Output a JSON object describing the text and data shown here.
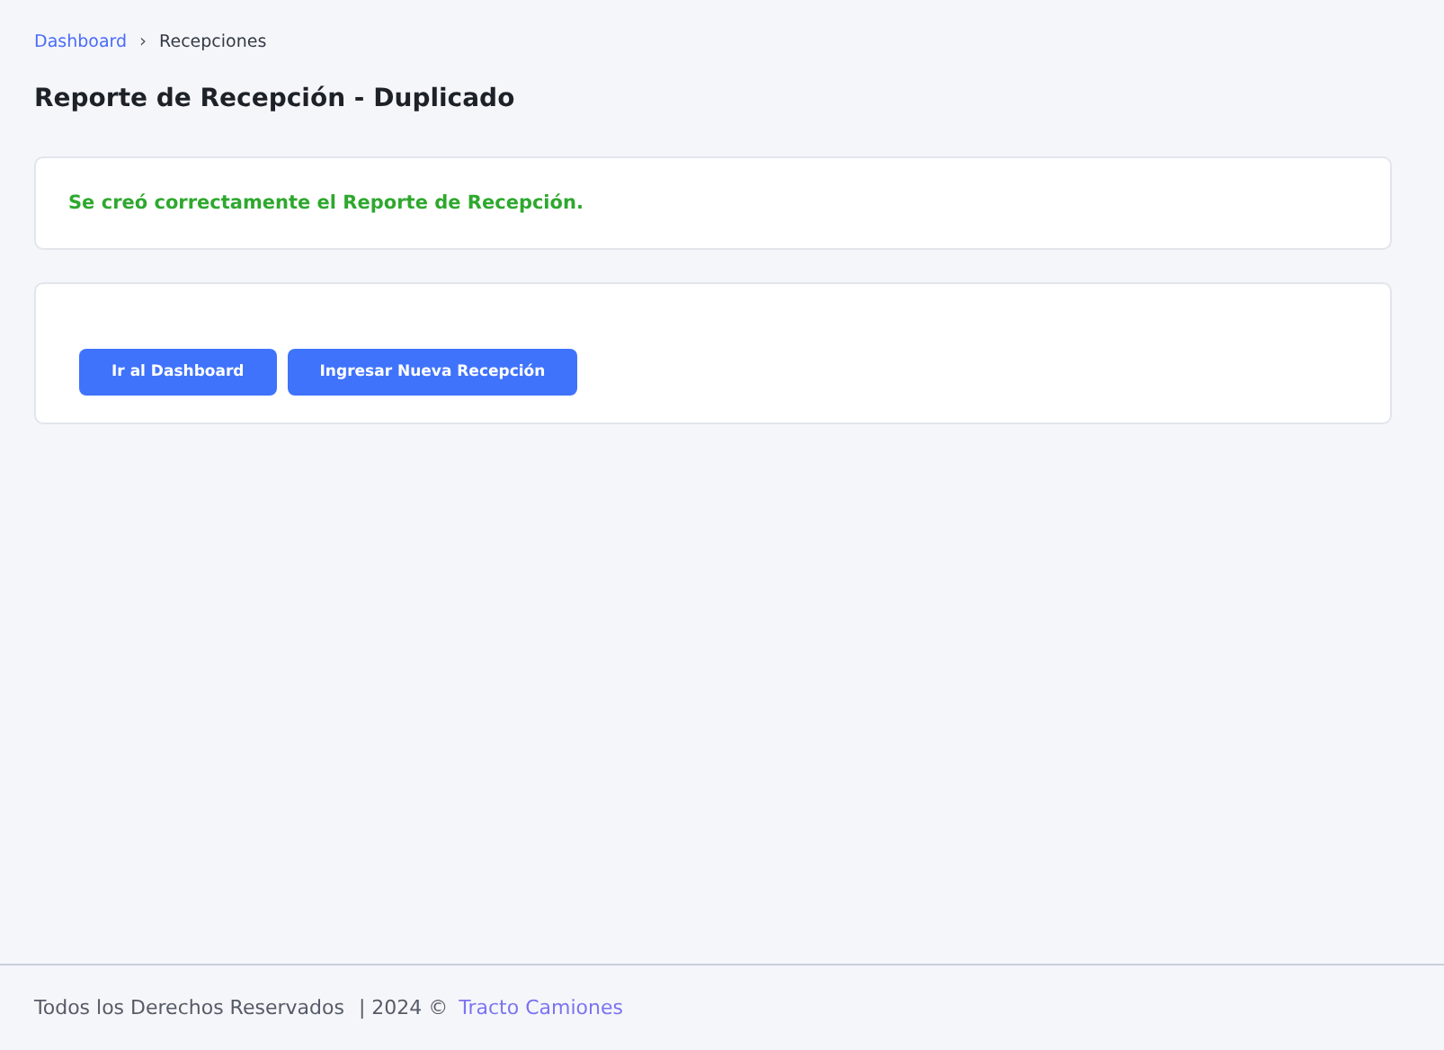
{
  "breadcrumb": {
    "items": [
      {
        "label": "Dashboard",
        "kind": "link"
      },
      {
        "label": "Recepciones",
        "kind": "current"
      }
    ],
    "separator": "›"
  },
  "title": "Reporte de Recepción - Duplicado",
  "alert": {
    "message": "Se creó correctamente el Reporte de Recepción."
  },
  "buttons": [
    {
      "label": "Ir al Dashboard"
    },
    {
      "label": "Ingresar Nueva Recepción"
    }
  ],
  "footer": {
    "text": "Todos los Derechos Reservados",
    "year": "| 2024 ©",
    "link": "Tracto Camiones"
  }
}
